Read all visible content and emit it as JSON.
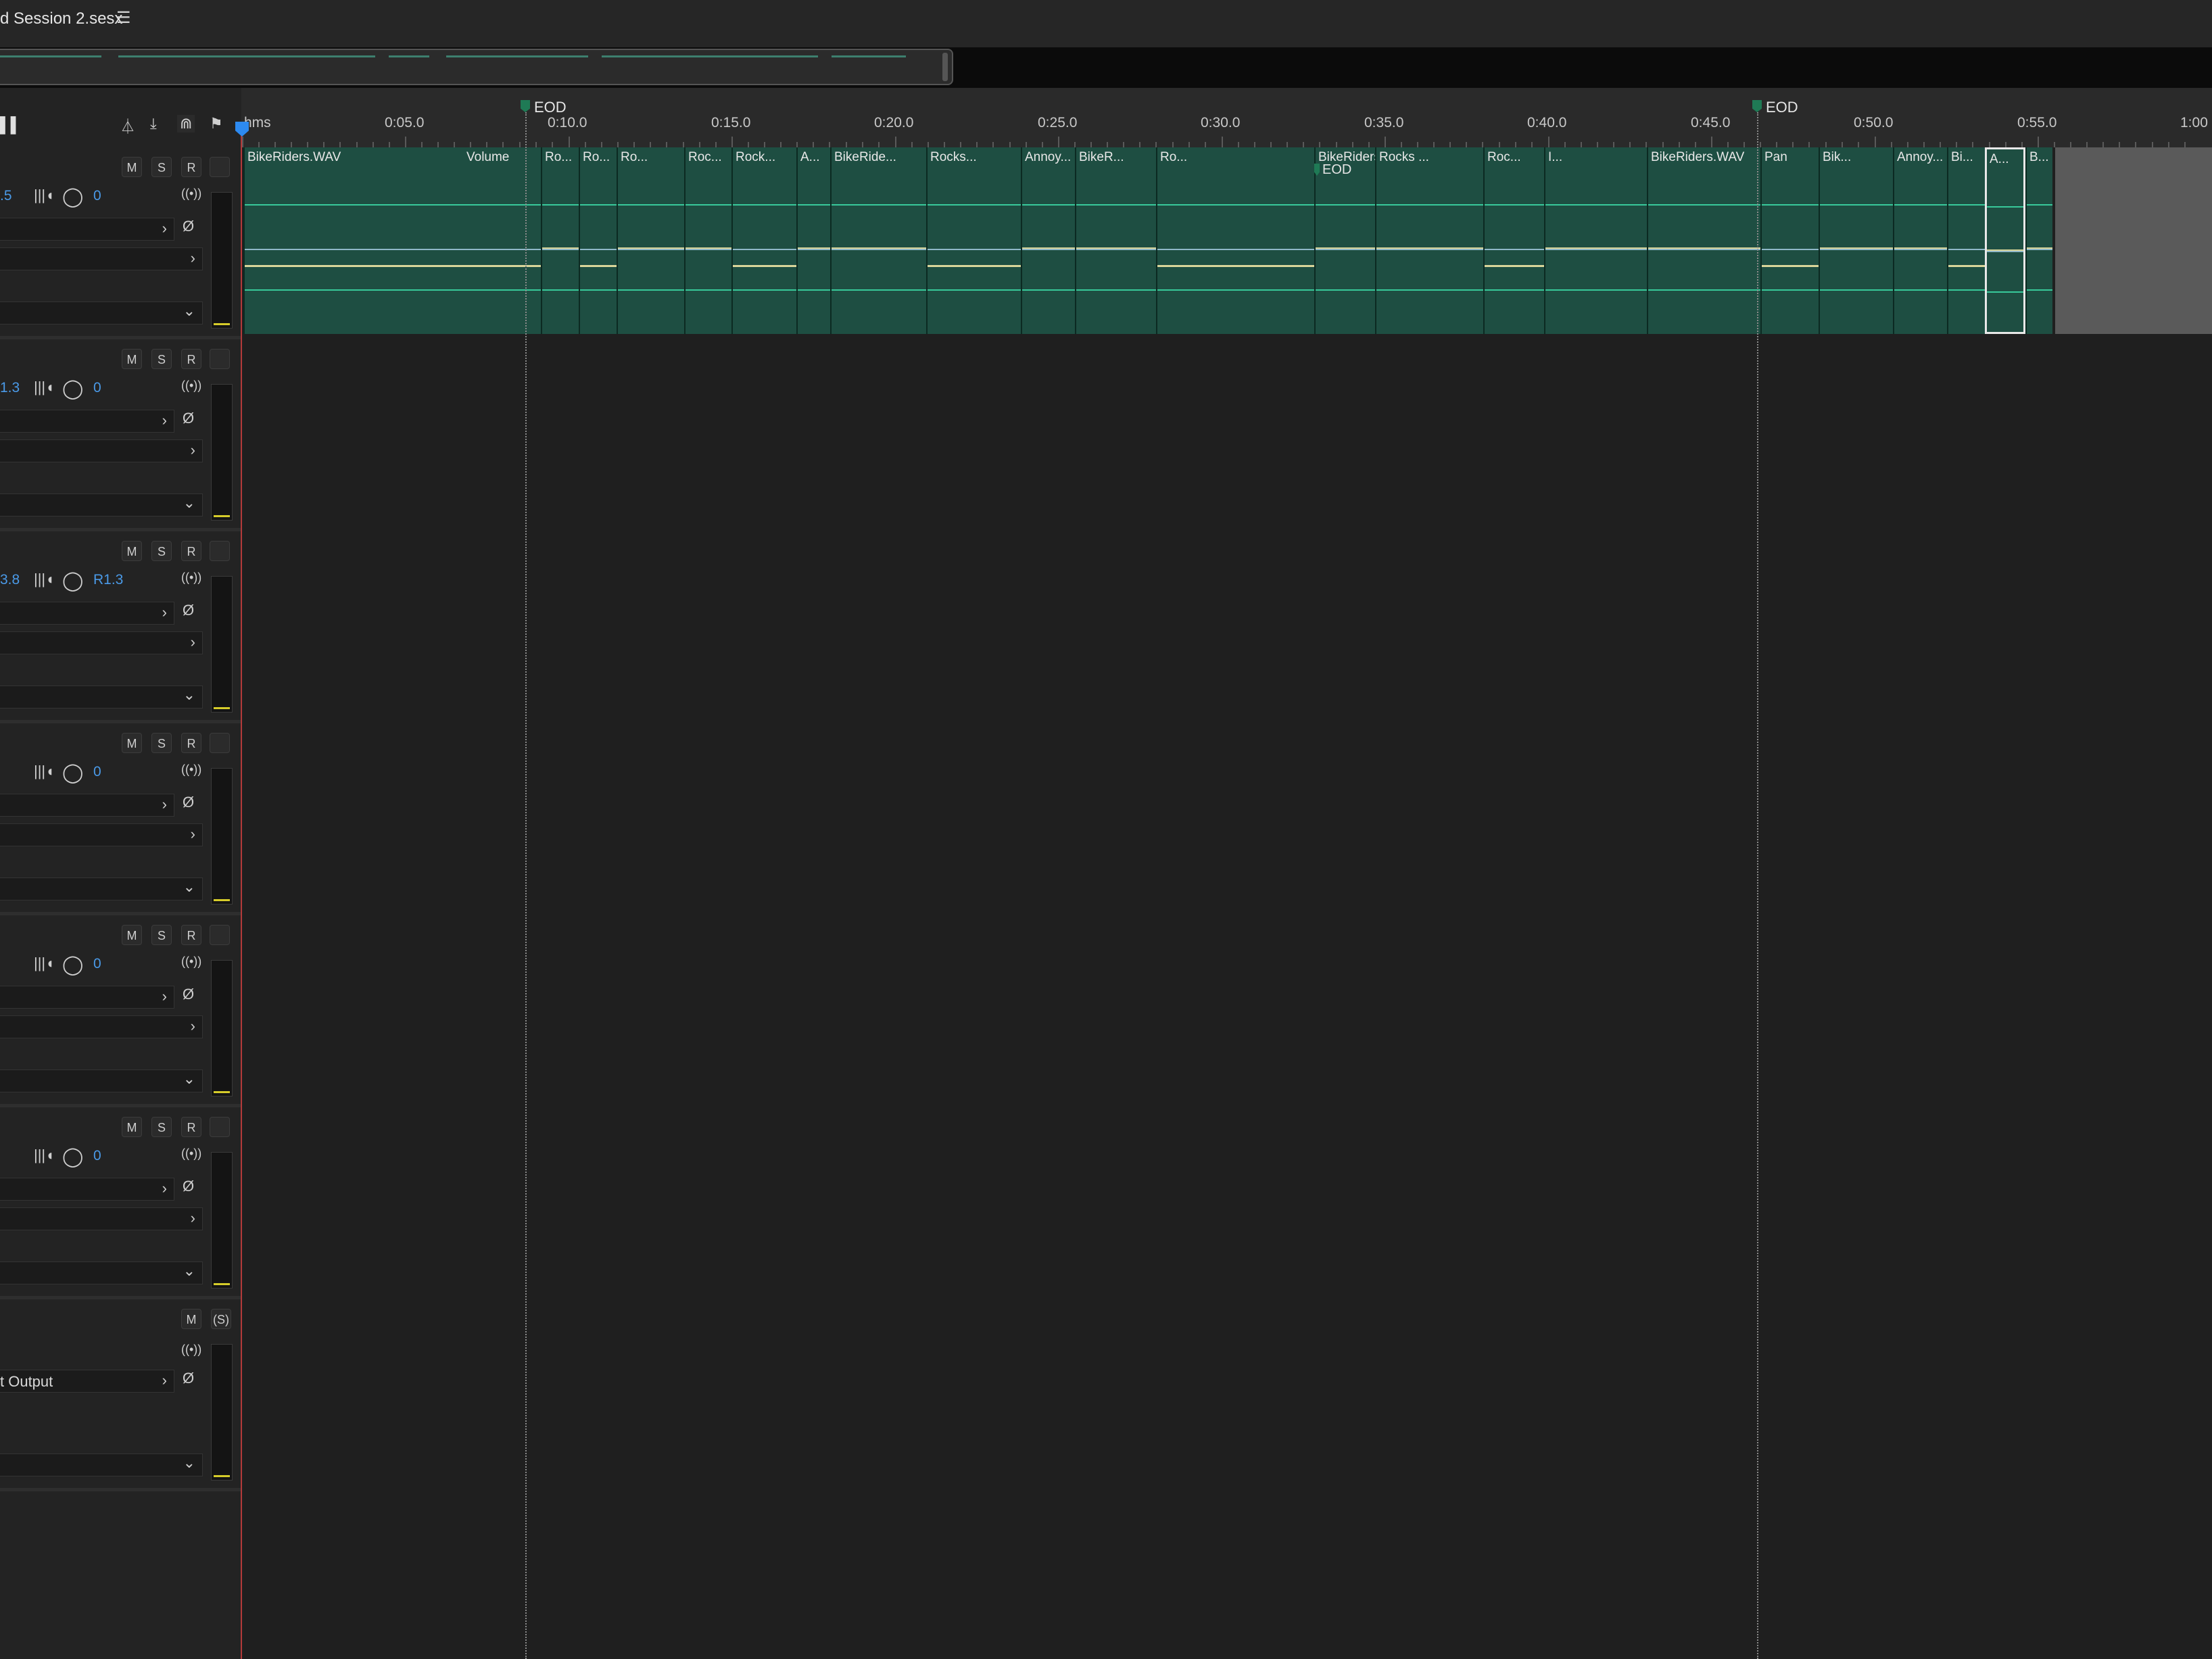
{
  "window": {
    "title": "d Session 2.sesx",
    "menu_icon": "hamburger-menu-icon"
  },
  "ruler": {
    "unit_label": "hms",
    "ticks": [
      "0:05.0",
      "0:10.0",
      "0:15.0",
      "0:20.0",
      "0:25.0",
      "0:30.0",
      "0:35.0",
      "0:40.0",
      "0:45.0",
      "0:50.0",
      "0:55.0",
      "1:00"
    ]
  },
  "markers": [
    {
      "label": "EOD"
    },
    {
      "label": "EOD"
    },
    {
      "label": "EOD"
    }
  ],
  "tracks": [
    {
      "volume": ".5",
      "pan": "0",
      "buttons": [
        "M",
        "S",
        "R"
      ]
    },
    {
      "volume": "1.3",
      "pan": "0",
      "buttons": [
        "M",
        "S",
        "R"
      ]
    },
    {
      "volume": "3.8",
      "pan": "R1.3",
      "buttons": [
        "M",
        "S",
        "R"
      ]
    },
    {
      "volume": "",
      "pan": "0",
      "buttons": [
        "M",
        "S",
        "R"
      ]
    },
    {
      "volume": "",
      "pan": "0",
      "buttons": [
        "M",
        "S",
        "R"
      ]
    },
    {
      "volume": "",
      "pan": "0",
      "buttons": [
        "M",
        "S",
        "R"
      ]
    }
  ],
  "master": {
    "output_label": "t Output",
    "buttons": [
      "M",
      "(S)"
    ]
  },
  "clips": [
    {
      "name": "BikeRiders.WAV"
    },
    {
      "name": "Volume"
    },
    {
      "name": "Ro..."
    },
    {
      "name": "Ro..."
    },
    {
      "name": "Ro..."
    },
    {
      "name": "Roc..."
    },
    {
      "name": "Rock..."
    },
    {
      "name": "A..."
    },
    {
      "name": "BikeRide..."
    },
    {
      "name": "Rocks..."
    },
    {
      "name": "Annoy..."
    },
    {
      "name": "BikeR..."
    },
    {
      "name": "Ro..."
    },
    {
      "name": "BikeRiders"
    },
    {
      "name": "Rocks ..."
    },
    {
      "name": "Roc..."
    },
    {
      "name": "I..."
    },
    {
      "name": "BikeRiders.WAV"
    },
    {
      "name": "Pan"
    },
    {
      "name": "Bik..."
    },
    {
      "name": "Annoy..."
    },
    {
      "name": "Bi..."
    },
    {
      "name": "A..."
    },
    {
      "name": "B..."
    }
  ]
}
